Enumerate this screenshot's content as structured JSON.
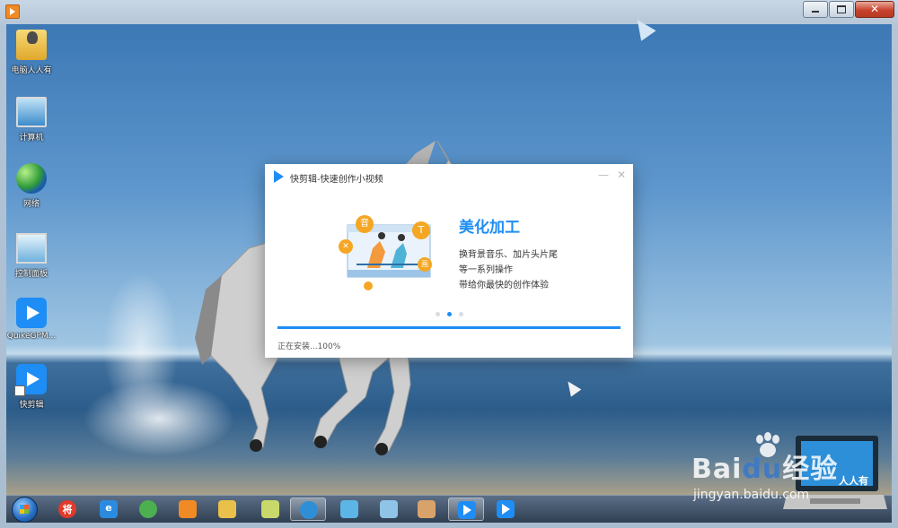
{
  "desktop": {
    "icons": [
      {
        "label": "电脑人人有",
        "kind": "folder"
      },
      {
        "label": "计算机",
        "kind": "computer"
      },
      {
        "label": "网络",
        "kind": "network"
      },
      {
        "label": "控制面板",
        "kind": "control-panel"
      },
      {
        "label": "QuikeGPM...",
        "kind": "app"
      },
      {
        "label": "快剪辑",
        "kind": "app-shortcut"
      }
    ]
  },
  "installer": {
    "title": "快剪辑-快速创作小视频",
    "minimize_glyph": "—",
    "close_glyph": "✕",
    "headline": "美化加工",
    "lines": [
      "换背景音乐、加片头片尾",
      "等一系列操作",
      "带给你最快的创作体验"
    ],
    "illustration_badges": [
      "音",
      "T",
      "✕",
      "画"
    ],
    "carousel": {
      "count": 3,
      "active_index": 1
    },
    "progress_fraction": 1.0,
    "status": "正在安装...100%",
    "accent_color": "#1e8df5"
  },
  "taskbar": {
    "items": [
      {
        "name": "start-button"
      },
      {
        "name": "app-red",
        "glyph": "将",
        "color": "#e23a2a"
      },
      {
        "name": "internet-explorer",
        "glyph": "e",
        "color": "#2a8be0"
      },
      {
        "name": "chrome",
        "glyph": "",
        "color": "#4caf50"
      },
      {
        "name": "media-player",
        "glyph": "",
        "color": "#f08a24"
      },
      {
        "name": "file-explorer",
        "glyph": "",
        "color": "#e8c04a"
      },
      {
        "name": "folder-app",
        "glyph": "",
        "color": "#c9d86a"
      },
      {
        "name": "browser-360",
        "glyph": "",
        "color": "#2f8fd6",
        "active": true
      },
      {
        "name": "settings-app",
        "glyph": "",
        "color": "#5bb6e6"
      },
      {
        "name": "control-panel",
        "glyph": "",
        "color": "#8fc3e8"
      },
      {
        "name": "paint-app",
        "glyph": "",
        "color": "#d8a36a"
      },
      {
        "name": "kuaijianji-installer",
        "glyph": "",
        "color": "#1e8df5",
        "active": true
      },
      {
        "name": "kuaijianji",
        "glyph": "",
        "color": "#1e8df5"
      }
    ]
  },
  "watermark": {
    "brand_left": "Bai",
    "brand_mid": "du",
    "brand_right": "经验",
    "url": "jingyan.baidu.com",
    "laptop_text": "人人有"
  }
}
